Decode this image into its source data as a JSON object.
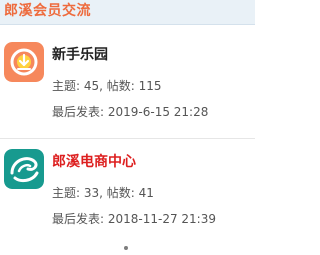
{
  "header": {
    "title": "郎溪会员交流"
  },
  "forums": [
    {
      "name": "新手乐园",
      "stats": "主题: 45, 帖数: 115",
      "last_post": "最后发表: 2019-6-15 21:28",
      "icon": "orange-download-icon",
      "icon_color": "#f6885c"
    },
    {
      "name": "郎溪电商中心",
      "stats": "主题: 33, 帖数: 41",
      "last_post": "最后发表: 2018-11-27 21:39",
      "icon": "teal-swirl-icon",
      "icon_color": "#179a8f"
    }
  ],
  "colors": {
    "header_bg": "#e9f1f7",
    "header_title": "#ee6b3d",
    "highlight_name": "#dd1f1f"
  }
}
